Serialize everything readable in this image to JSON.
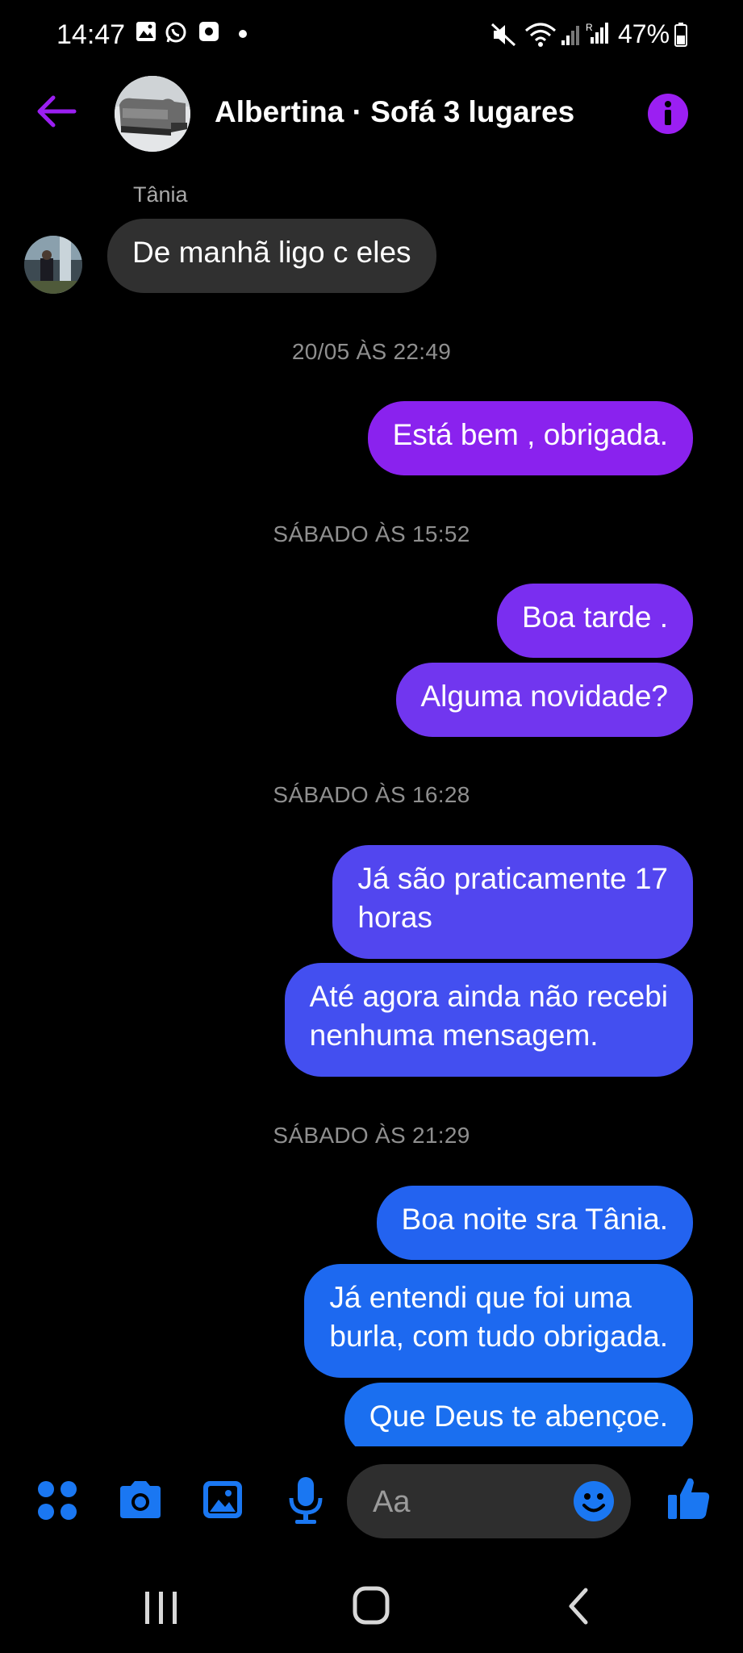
{
  "status_bar": {
    "time": "14:47",
    "battery": "47%"
  },
  "header": {
    "title": "Albertina · Sofá 3 lugares"
  },
  "colors": {
    "accent_purple": "#9b1ff2",
    "messenger_blue": "#1a6ff0",
    "incoming_bubble": "#303030"
  },
  "messages": {
    "sender_name": "Tânia",
    "incoming_1": "De manhã ligo c eles",
    "ts_1": "20/05 ÀS 22:49",
    "out_1": "Está bem , obrigada.",
    "ts_2": "SÁBADO ÀS 15:52",
    "out_2": "Boa tarde .",
    "out_3": "Alguma novidade?",
    "ts_3": "SÁBADO ÀS 16:28",
    "out_4_line1": "Já são praticamente 17",
    "out_4_line2": "horas",
    "out_5_line1": "Até agora ainda não recebi",
    "out_5_line2": "nenhuma mensagem.",
    "ts_4": "SÁBADO ÀS 21:29",
    "out_6": "Boa noite sra Tânia.",
    "out_7_line1": "Já entendi que foi uma",
    "out_7_line2": "burla,  com tudo obrigada.",
    "out_8": "Que Deus te abençoe."
  },
  "composer": {
    "placeholder": "Aa"
  },
  "icons": [
    "back-arrow-icon",
    "info-icon",
    "apps-icon",
    "camera-icon",
    "gallery-icon",
    "microphone-icon",
    "emoji-icon",
    "like-icon",
    "recents-icon",
    "home-icon",
    "nav-back-icon"
  ]
}
